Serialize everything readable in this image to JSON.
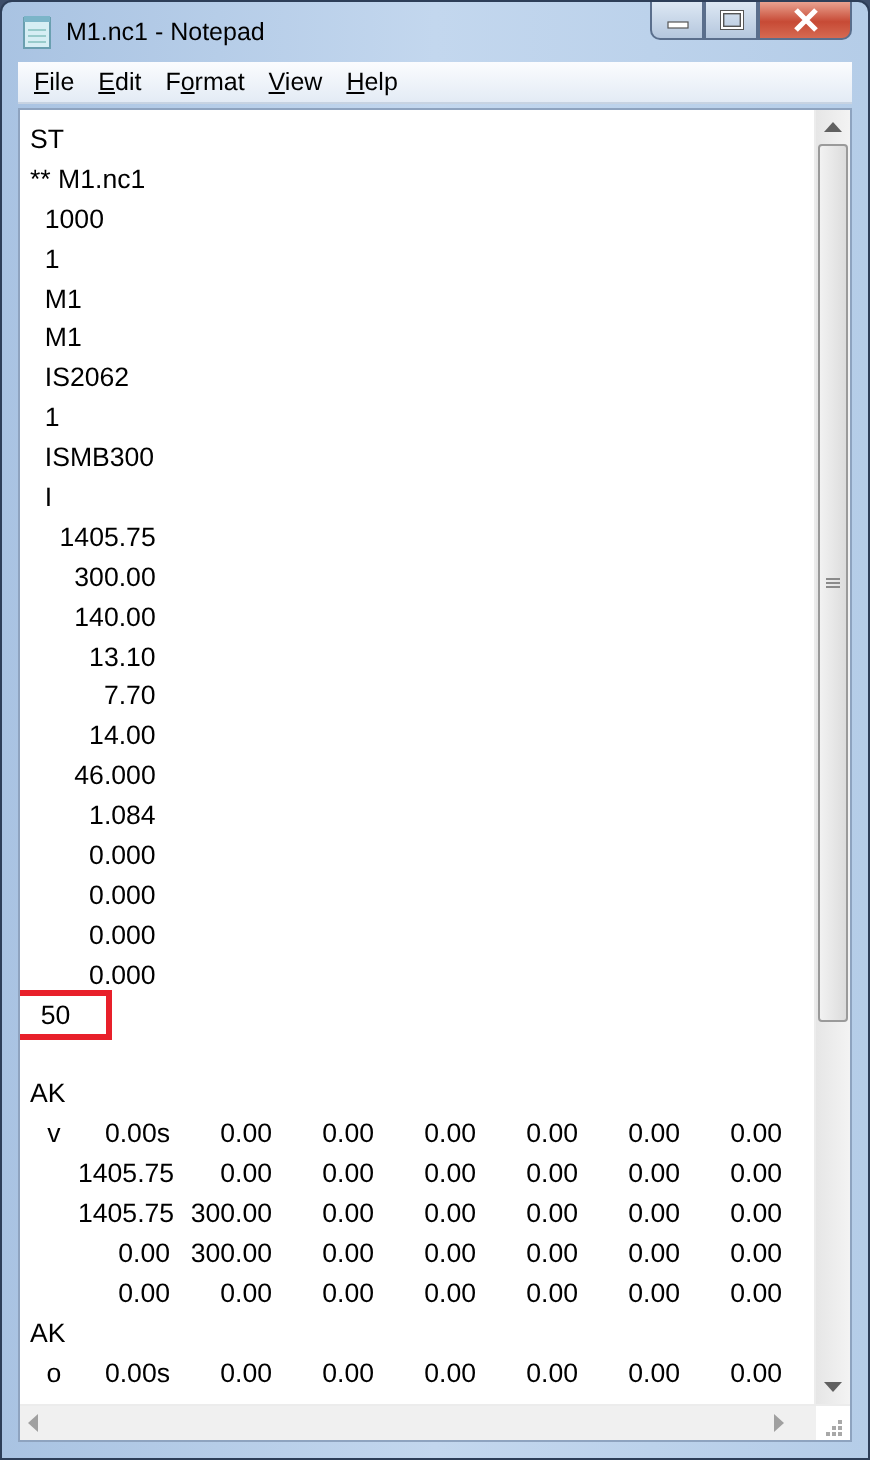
{
  "window": {
    "title": "M1.nc1 - Notepad"
  },
  "menu": [
    {
      "access_key": "F",
      "label_rest": "ile"
    },
    {
      "access_key": "E",
      "label_rest": "dit"
    },
    {
      "label_start": "F",
      "access_key": "o",
      "label_rest": "rmat"
    },
    {
      "access_key": "V",
      "label_rest": "iew"
    },
    {
      "access_key": "H",
      "label_rest": "elp"
    }
  ],
  "document": {
    "lines": [
      {
        "kind": "text",
        "text": "ST",
        "highlighted": false
      },
      {
        "kind": "text",
        "text": "** M1.nc1",
        "highlighted": false
      },
      {
        "kind": "text",
        "text": "  1000",
        "highlighted": false
      },
      {
        "kind": "text",
        "text": "  1",
        "highlighted": false
      },
      {
        "kind": "text",
        "text": "  M1",
        "highlighted": false
      },
      {
        "kind": "text",
        "text": "  M1",
        "highlighted": false
      },
      {
        "kind": "text",
        "text": "  IS2062",
        "highlighted": false
      },
      {
        "kind": "text",
        "text": "  1",
        "highlighted": false
      },
      {
        "kind": "text",
        "text": "  ISMB300",
        "highlighted": false
      },
      {
        "kind": "text",
        "text": "  I",
        "highlighted": false
      },
      {
        "kind": "text",
        "text": "    1405.75",
        "highlighted": false
      },
      {
        "kind": "text",
        "text": "      300.00",
        "highlighted": false
      },
      {
        "kind": "text",
        "text": "      140.00",
        "highlighted": false
      },
      {
        "kind": "text",
        "text": "        13.10",
        "highlighted": false
      },
      {
        "kind": "text",
        "text": "          7.70",
        "highlighted": false
      },
      {
        "kind": "text",
        "text": "        14.00",
        "highlighted": false
      },
      {
        "kind": "text",
        "text": "      46.000",
        "highlighted": false
      },
      {
        "kind": "text",
        "text": "        1.084",
        "highlighted": false
      },
      {
        "kind": "text",
        "text": "        0.000",
        "highlighted": false
      },
      {
        "kind": "text",
        "text": "        0.000",
        "highlighted": false
      },
      {
        "kind": "text",
        "text": "        0.000",
        "highlighted": false
      },
      {
        "kind": "text",
        "text": "        0.000",
        "highlighted": false
      },
      {
        "kind": "text",
        "text": "  50",
        "highlighted": true
      },
      {
        "kind": "blank"
      },
      {
        "kind": "text",
        "text": "AK",
        "highlighted": false
      },
      {
        "kind": "row",
        "cells": [
          "v",
          "0.00s",
          "0.00",
          "0.00",
          "0.00",
          "0.00",
          "0.00",
          "0.00"
        ]
      },
      {
        "kind": "row",
        "cells": [
          "",
          "1405.75",
          "0.00",
          "0.00",
          "0.00",
          "0.00",
          "0.00",
          "0.00"
        ]
      },
      {
        "kind": "row",
        "cells": [
          "",
          "1405.75",
          "300.00",
          "0.00",
          "0.00",
          "0.00",
          "0.00",
          "0.00"
        ]
      },
      {
        "kind": "row",
        "cells": [
          "",
          "0.00",
          "300.00",
          "0.00",
          "0.00",
          "0.00",
          "0.00",
          "0.00"
        ]
      },
      {
        "kind": "row",
        "cells": [
          "",
          "0.00",
          "0.00",
          "0.00",
          "0.00",
          "0.00",
          "0.00",
          "0.00"
        ]
      },
      {
        "kind": "text",
        "text": "AK",
        "highlighted": false
      },
      {
        "kind": "row",
        "cells": [
          "o",
          "0.00s",
          "0.00",
          "0.00",
          "0.00",
          "0.00",
          "0.00",
          "0.00"
        ]
      }
    ]
  }
}
